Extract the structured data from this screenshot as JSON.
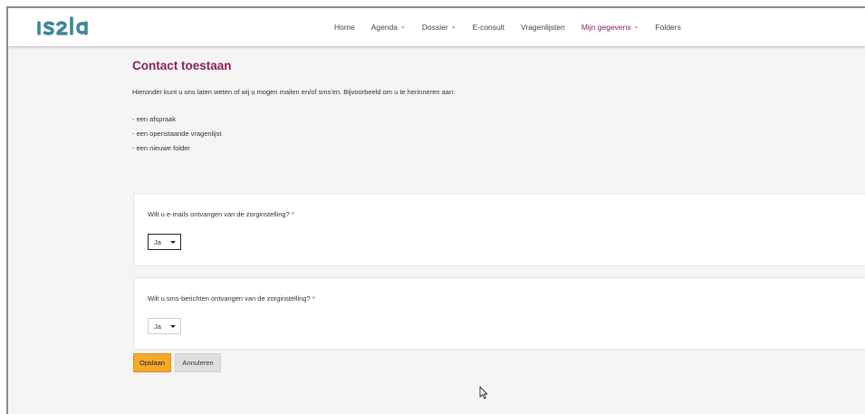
{
  "brand": {
    "logo_text": "ISala",
    "logo_color": "#3f8796"
  },
  "nav": {
    "items": [
      {
        "label": "Home",
        "dropdown": false
      },
      {
        "label": "Agenda",
        "dropdown": true
      },
      {
        "label": "Dossier",
        "dropdown": true
      },
      {
        "label": "E-consult",
        "dropdown": false
      },
      {
        "label": "Vragenlijsten",
        "dropdown": false
      },
      {
        "label": "Mijn gegevens",
        "dropdown": true,
        "active": true
      },
      {
        "label": "Folders",
        "dropdown": false
      }
    ],
    "active_color": "#8a1f5e"
  },
  "page": {
    "title": "Contact toestaan",
    "intro": "Hieronder kunt u ons laten weten of wij u mogen mailen en/of sms'en. Bijvoorbeeld om u te herinneren aan:",
    "list": [
      "- een afspraak",
      "- een openstaande vragenlijst",
      "- een nieuwe folder"
    ]
  },
  "form": {
    "email_question": "Wilt u e-mails ontvangen van de zorginstelling?",
    "email_value": "Ja",
    "sms_question": "Wilt u sms-berichten ontvangen van de zorginstelling?",
    "sms_value": "Ja",
    "required_marker": "*"
  },
  "actions": {
    "save_label": "Opslaan",
    "cancel_label": "Annuleren",
    "save_color": "#f4a92a"
  }
}
